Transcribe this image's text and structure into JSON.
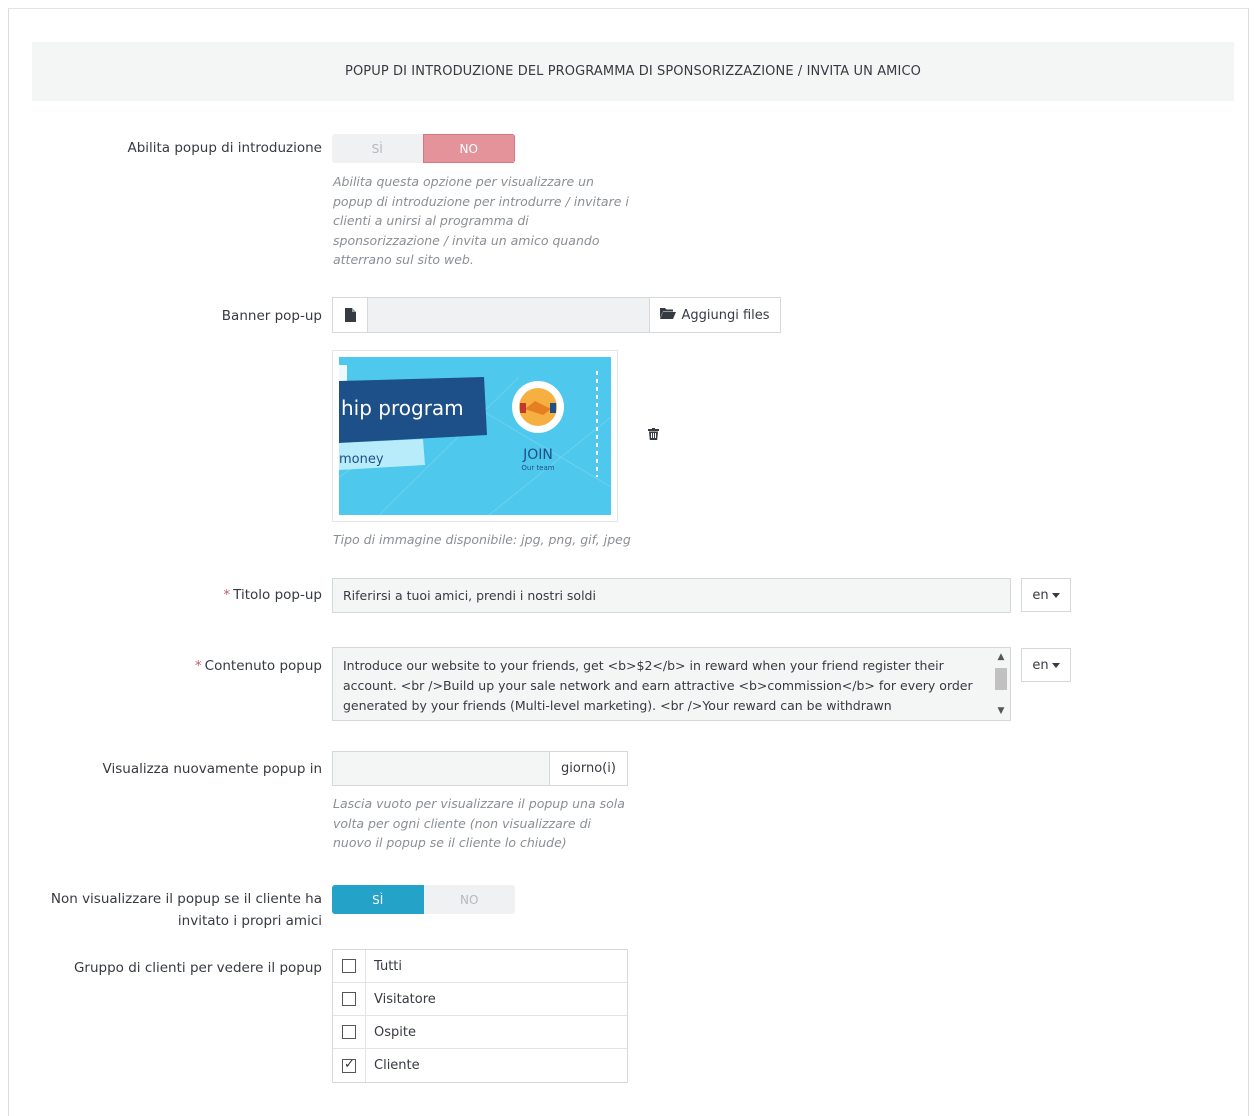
{
  "header": {
    "title": "POPUP DI INTRODUZIONE DEL PROGRAMMA DI SPONSORIZZAZIONE / INVITA UN AMICO"
  },
  "enable_popup": {
    "label": "Abilita popup di introduzione",
    "yes": "SÌ",
    "no": "NO",
    "selected": "NO",
    "help": "Abilita questa opzione per visualizzare un popup di introduzione per introdurre / invitare i clienti a unirsi al programma di sponsorizzazione / invita un amico quando atterrano sul sito web."
  },
  "banner": {
    "label": "Banner pop-up",
    "button": "Aggiungi files",
    "image_text": {
      "line1": "hip program",
      "line2": "money",
      "join": "JOIN",
      "team": "Our team"
    },
    "help": "Tipo di immagine disponibile: jpg, png, gif, jpeg"
  },
  "title": {
    "required": "*",
    "label": "Titolo pop-up",
    "value": "Riferirsi a tuoi amici, prendi i nostri soldi",
    "lang": "en"
  },
  "content": {
    "required": "*",
    "label": "Contenuto popup",
    "value": "Introduce our website to your friends, get <b>$2</b> in reward when your friend register their account. <br />Build up your sale network and earn attractive <b>commission</b> for every order generated by your friends (Multi-level marketing). <br />Your reward can be withdrawn",
    "lang": "en"
  },
  "redisplay": {
    "label": "Visualizza nuovamente popup in",
    "value": "",
    "addon": "giorno(i)",
    "help": "Lascia vuoto per visualizzare il popup una sola volta per ogni cliente (non visualizzare di nuovo il popup se il cliente lo chiude)"
  },
  "hide_if_invited": {
    "label_line1": "Non visualizzare il popup se il cliente ha",
    "label_line2": "invitato i propri amici",
    "yes": "SÌ",
    "no": "NO",
    "selected": "SÌ"
  },
  "customer_groups": {
    "label": "Gruppo di clienti per vedere il popup",
    "items": [
      {
        "name": "Tutti",
        "checked": false
      },
      {
        "name": "Visitatore",
        "checked": false
      },
      {
        "name": "Ospite",
        "checked": false
      },
      {
        "name": "Cliente",
        "checked": true
      }
    ]
  },
  "colors": {
    "no_active": "#e4939b",
    "yes_active": "#25a2c7",
    "banner_bg": "#4ec8ec",
    "banner_dark": "#1d4f88"
  }
}
